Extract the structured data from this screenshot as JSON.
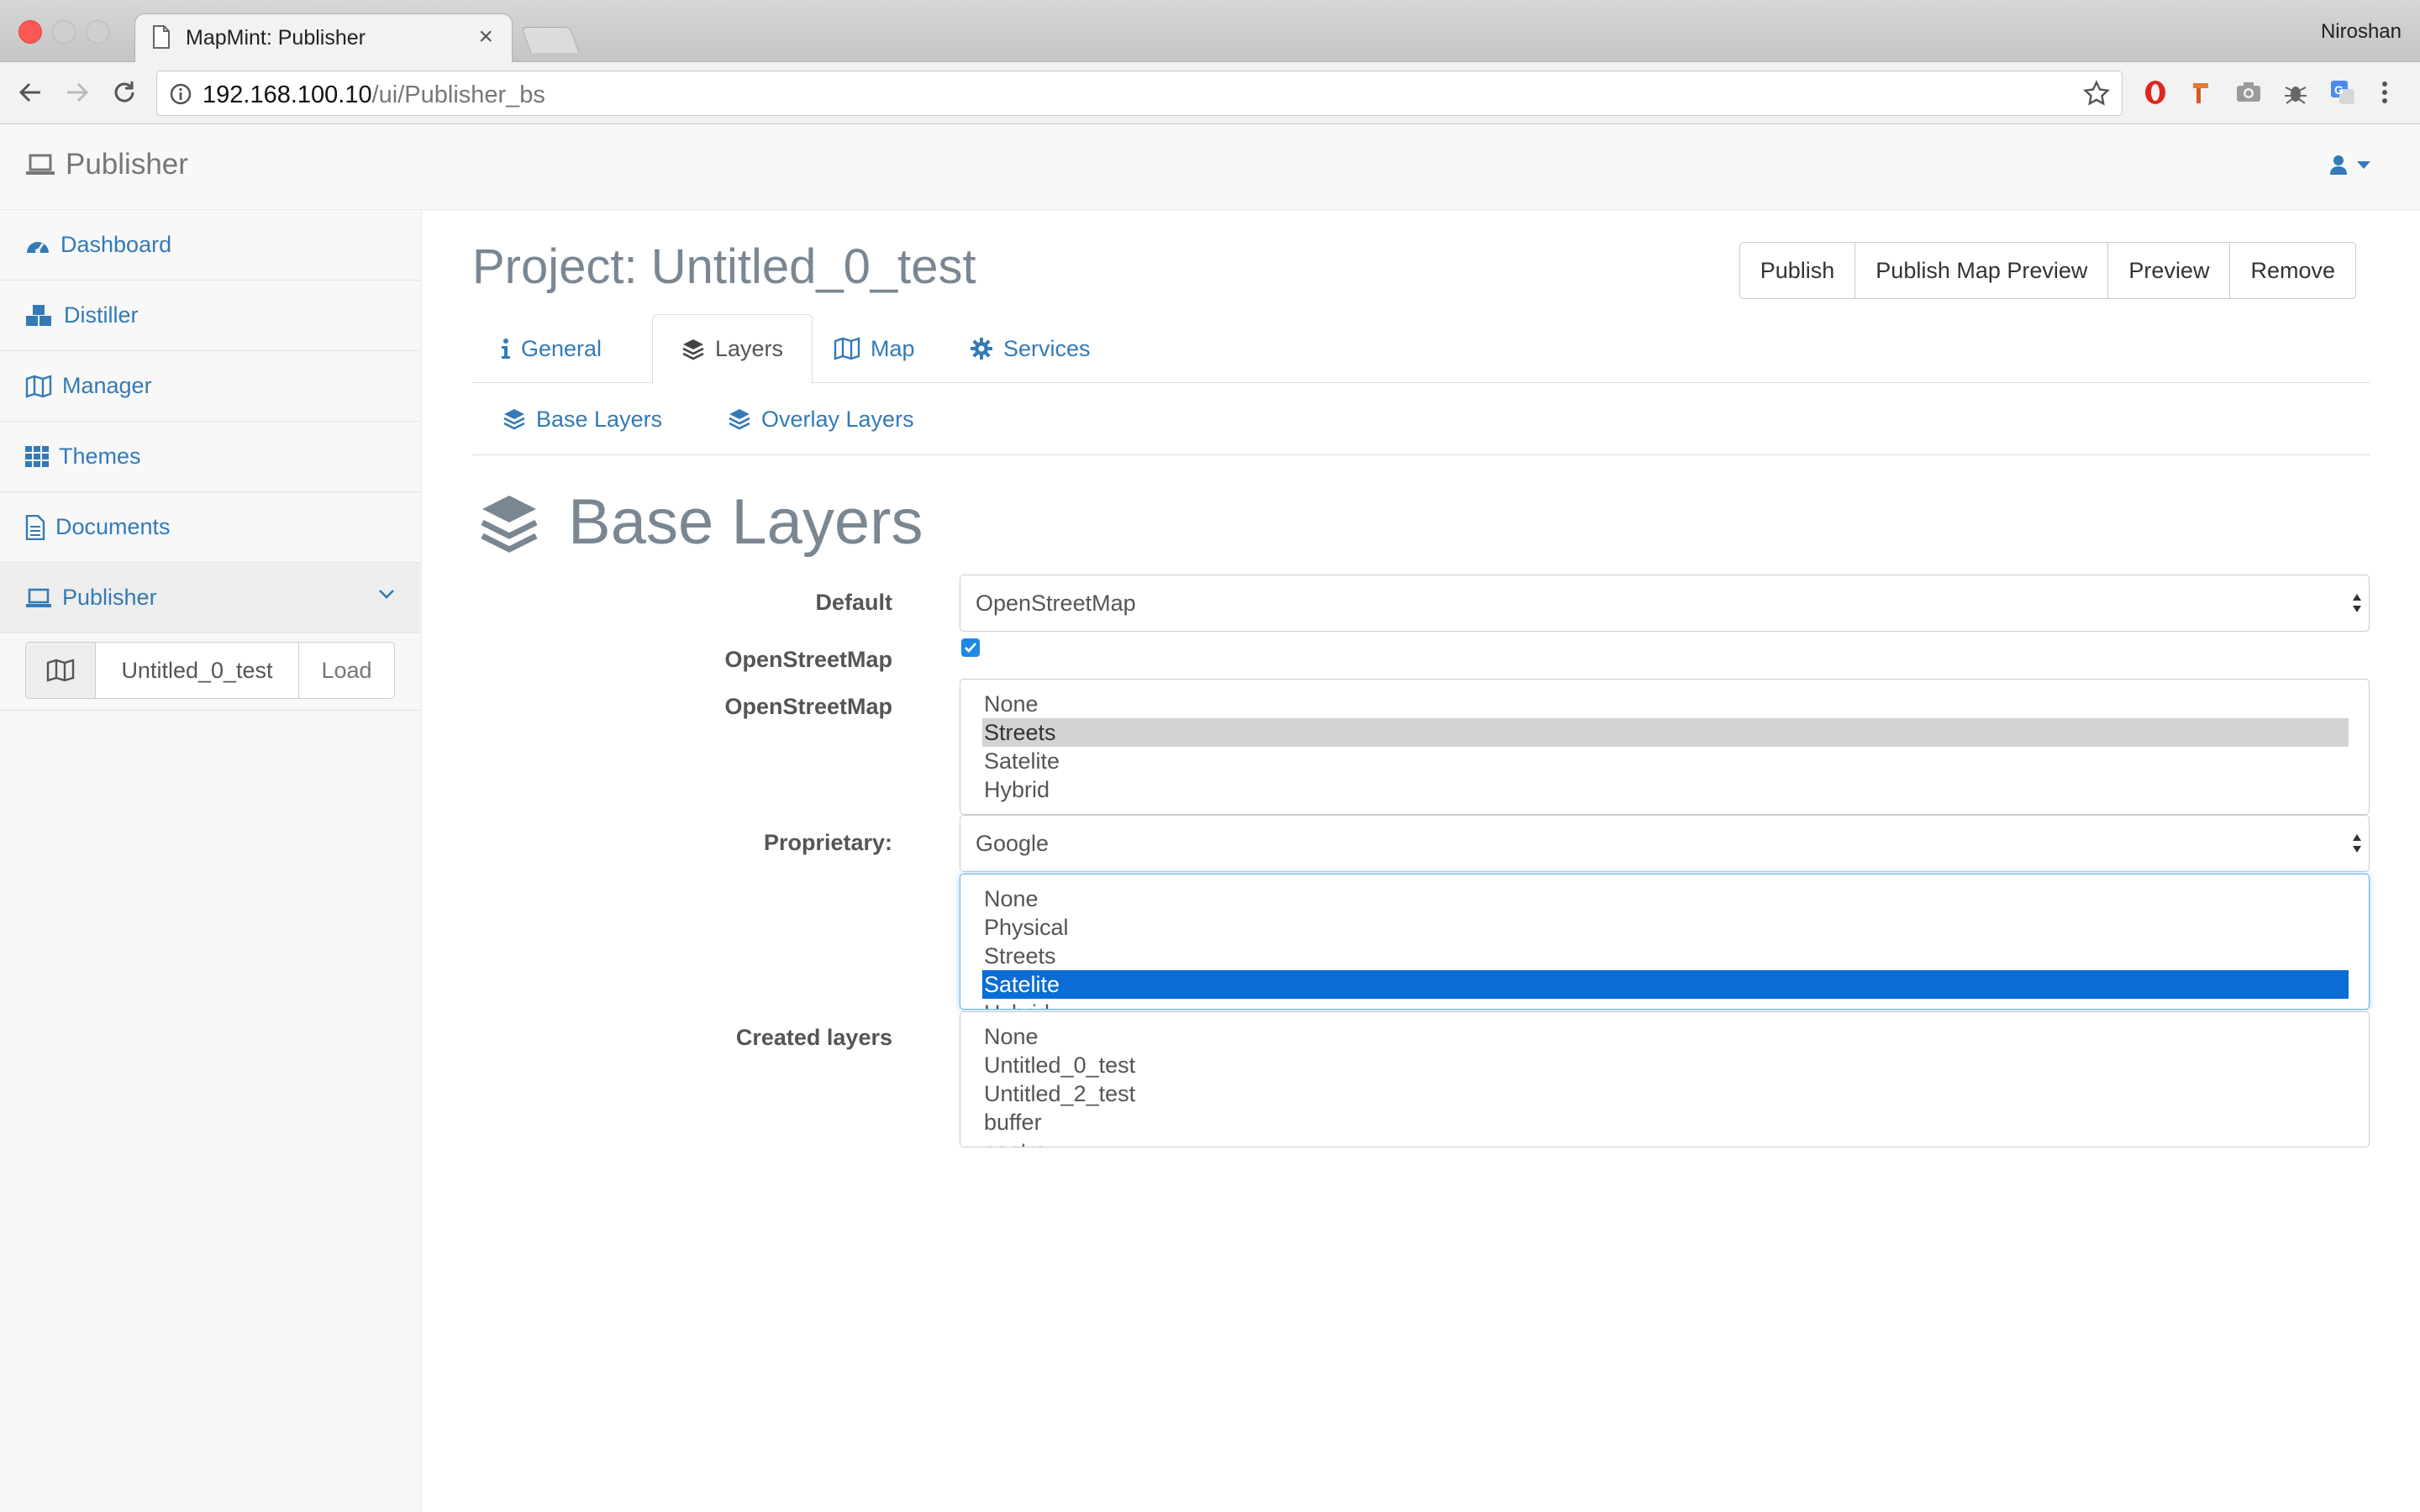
{
  "browser": {
    "tab_title": "MapMint: Publisher",
    "profile_name": "Niroshan",
    "url_host": "192.168.100.10",
    "url_path": "/ui/Publisher_bs"
  },
  "app": {
    "brand": "Publisher"
  },
  "sidebar": {
    "items": [
      {
        "label": "Dashboard",
        "icon": "dashboard-icon"
      },
      {
        "label": "Distiller",
        "icon": "cubes-icon"
      },
      {
        "label": "Manager",
        "icon": "map-icon"
      },
      {
        "label": "Themes",
        "icon": "grid-icon"
      },
      {
        "label": "Documents",
        "icon": "document-icon"
      },
      {
        "label": "Publisher",
        "icon": "laptop-icon",
        "active": true
      }
    ],
    "project_input": "Untitled_0_test",
    "load_label": "Load"
  },
  "main": {
    "project_title": "Project: Untitled_0_test",
    "actions": [
      "Publish",
      "Publish Map Preview",
      "Preview",
      "Remove"
    ],
    "tabs": [
      {
        "label": "General",
        "icon": "info-icon"
      },
      {
        "label": "Layers",
        "icon": "layers-icon",
        "active": true
      },
      {
        "label": "Map",
        "icon": "map-icon"
      },
      {
        "label": "Services",
        "icon": "gear-icon"
      }
    ],
    "subtabs": [
      {
        "label": "Base Layers",
        "icon": "layers-icon"
      },
      {
        "label": "Overlay Layers",
        "icon": "layers-icon"
      }
    ],
    "section_title": "Base Layers",
    "form": {
      "default_label": "Default",
      "default_value": "OpenStreetMap",
      "osm_check_label": "OpenStreetMap",
      "osm_checked": true,
      "osm_list_label": "OpenStreetMap",
      "osm_options": [
        "None",
        "Streets",
        "Satelite",
        "Hybrid"
      ],
      "osm_selected": "Streets",
      "proprietary_label": "Proprietary:",
      "proprietary_value": "Google",
      "google_options": [
        "None",
        "Physical",
        "Streets",
        "Satelite",
        "Hybrid"
      ],
      "google_selected": "Satelite",
      "created_label": "Created layers",
      "created_options": [
        "None",
        "Untitled_0_test",
        "Untitled_2_test",
        "buffer",
        "centre"
      ]
    }
  },
  "colors": {
    "link": "#337ab7",
    "selected_blue": "#0a6dd6",
    "selected_gray": "#d3d3d3",
    "title_gray": "#7a8793"
  }
}
